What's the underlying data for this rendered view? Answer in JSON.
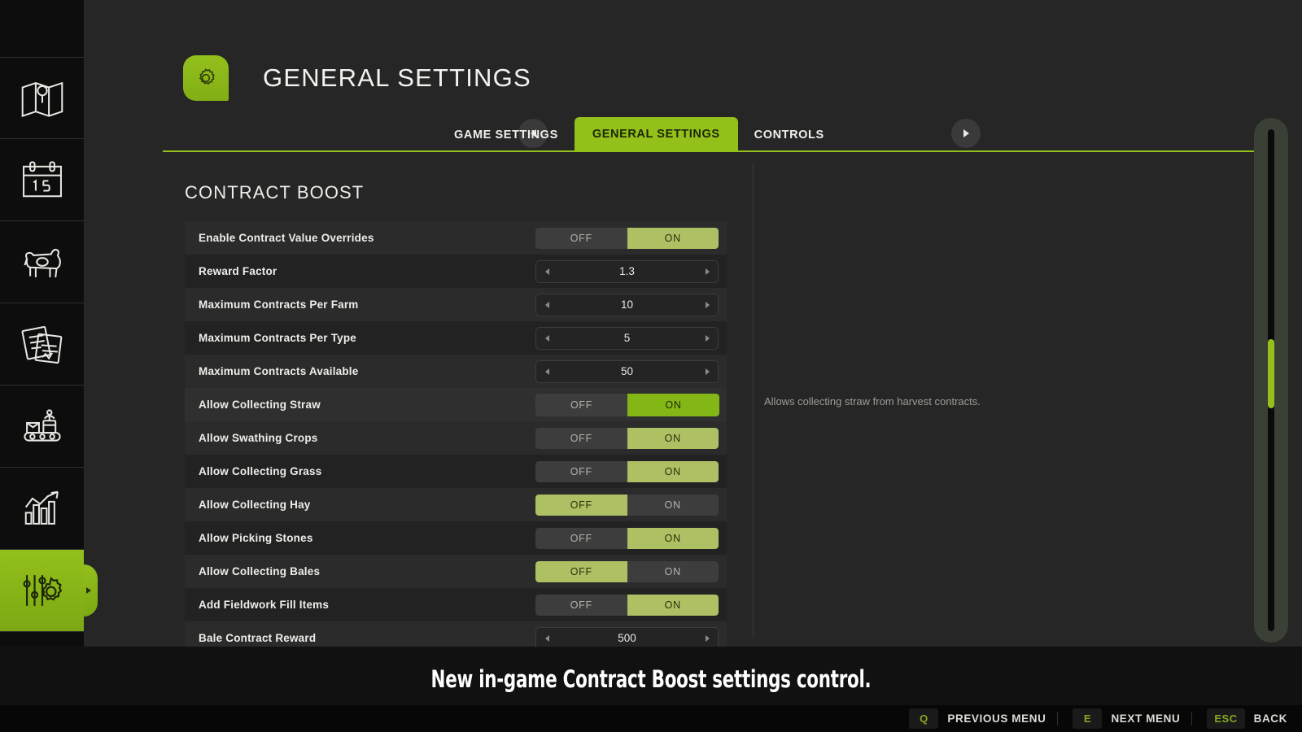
{
  "sidebar": {
    "items": [
      {
        "name": "map",
        "icon": "map-icon",
        "active": false
      },
      {
        "name": "calendar",
        "icon": "calendar-icon",
        "label": "15",
        "active": false
      },
      {
        "name": "animals",
        "icon": "cow-icon",
        "active": false
      },
      {
        "name": "contracts",
        "icon": "documents-icon",
        "active": false
      },
      {
        "name": "production",
        "icon": "conveyor-icon",
        "active": false
      },
      {
        "name": "statistics",
        "icon": "bar-chart-icon",
        "active": false
      },
      {
        "name": "settings",
        "icon": "sliders-gear-icon",
        "active": true
      }
    ]
  },
  "header": {
    "title": "GENERAL SETTINGS",
    "badge_icon": "gear-icon"
  },
  "tabs": {
    "prev_icon": "arrow-left-icon",
    "next_icon": "arrow-right-icon",
    "items": [
      {
        "label": "GAME SETTINGS",
        "active": false
      },
      {
        "label": "GENERAL SETTINGS",
        "active": true
      },
      {
        "label": "CONTROLS",
        "active": false
      }
    ]
  },
  "content": {
    "section_title": "CONTRACT BOOST",
    "toggle_off": "OFF",
    "toggle_on": "ON",
    "rows": [
      {
        "label": "Enable Contract Value Overrides",
        "type": "toggle",
        "value": "ON",
        "selected": false
      },
      {
        "label": "Reward Factor",
        "type": "spinner",
        "value": "1.3",
        "selected": false
      },
      {
        "label": "Maximum Contracts Per Farm",
        "type": "spinner",
        "value": "10",
        "selected": false
      },
      {
        "label": "Maximum Contracts Per Type",
        "type": "spinner",
        "value": "5",
        "selected": false
      },
      {
        "label": "Maximum Contracts Available",
        "type": "spinner",
        "value": "50",
        "selected": false
      },
      {
        "label": "Allow Collecting Straw",
        "type": "toggle",
        "value": "ON",
        "selected": true
      },
      {
        "label": "Allow Swathing Crops",
        "type": "toggle",
        "value": "ON",
        "selected": false
      },
      {
        "label": "Allow Collecting Grass",
        "type": "toggle",
        "value": "ON",
        "selected": false
      },
      {
        "label": "Allow Collecting Hay",
        "type": "toggle",
        "value": "OFF",
        "selected": false
      },
      {
        "label": "Allow Picking Stones",
        "type": "toggle",
        "value": "ON",
        "selected": false
      },
      {
        "label": "Allow Collecting Bales",
        "type": "toggle",
        "value": "OFF",
        "selected": false
      },
      {
        "label": "Add Fieldwork Fill Items",
        "type": "toggle",
        "value": "ON",
        "selected": false
      },
      {
        "label": "Bale Contract Reward",
        "type": "spinner",
        "value": "500",
        "selected": false
      }
    ],
    "help_text": "Allows collecting straw from harvest contracts."
  },
  "caption": "New in-game Contract Boost settings control.",
  "keybar": [
    {
      "key": "Q",
      "label": "PREVIOUS MENU"
    },
    {
      "key": "E",
      "label": "NEXT MENU"
    },
    {
      "key": "ESC",
      "label": "BACK"
    }
  ],
  "colors": {
    "accent": "#93c01b",
    "accent_selected": "#82b715",
    "accent_muted": "#aec064",
    "panel": "#262626",
    "row": "#222222",
    "row_alt": "#2b2b2b"
  }
}
